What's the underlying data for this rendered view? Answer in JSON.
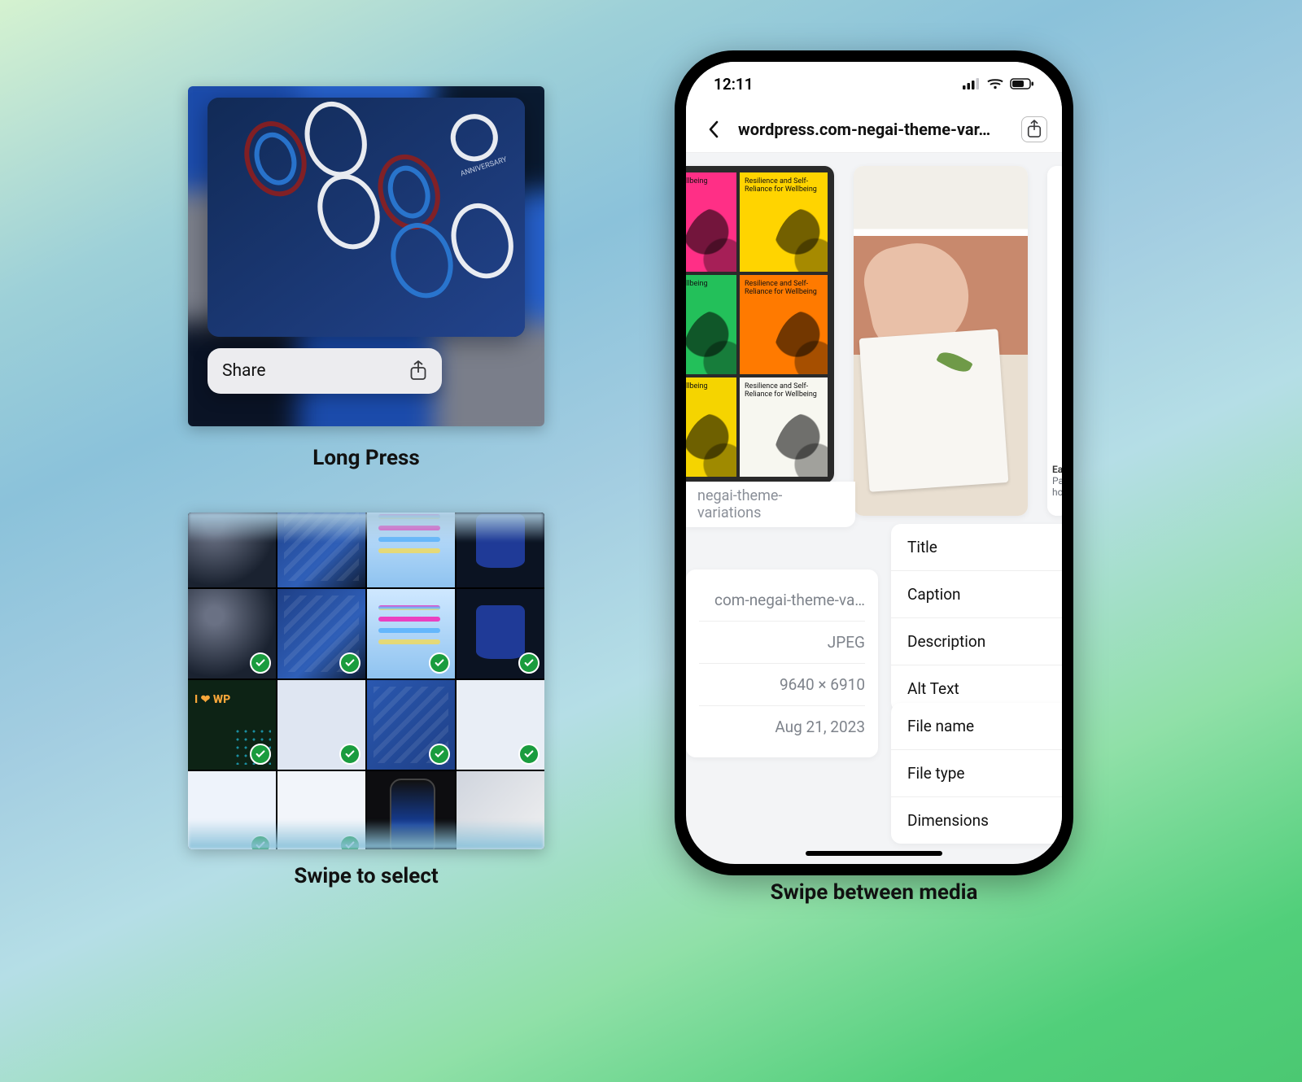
{
  "captions": {
    "long_press": "Long Press",
    "swipe_select": "Swipe to select",
    "swipe_media": "Swipe between media"
  },
  "long_press": {
    "share_label": "Share"
  },
  "select_grid": {
    "selected_indices": [
      0,
      1,
      2,
      3,
      4,
      5,
      6,
      7,
      8,
      9,
      10
    ]
  },
  "phone": {
    "status_time": "12:11",
    "nav_title": "wordpress.com-negai-theme-var…",
    "carousel": {
      "left_caption": "negai-theme-variations",
      "pop_text": "Resilience and Self-Reliance for Wellbeing",
      "pop_text_short": "d Self-\nWellbeing",
      "peek_line1": "Ea",
      "peek_line2": "Pa",
      "peek_line3": "ho"
    },
    "meta_primary": {
      "title_value": "com-negai-theme-va…",
      "file_type": "JPEG",
      "dimensions": "9640 × 6910",
      "date": "Aug 21, 2023"
    },
    "fields": {
      "title": "Title",
      "caption": "Caption",
      "description": "Description",
      "alt": "Alt Text"
    },
    "fields2": {
      "file_name": "File name",
      "file_type": "File type",
      "dimensions": "Dimensions"
    }
  }
}
